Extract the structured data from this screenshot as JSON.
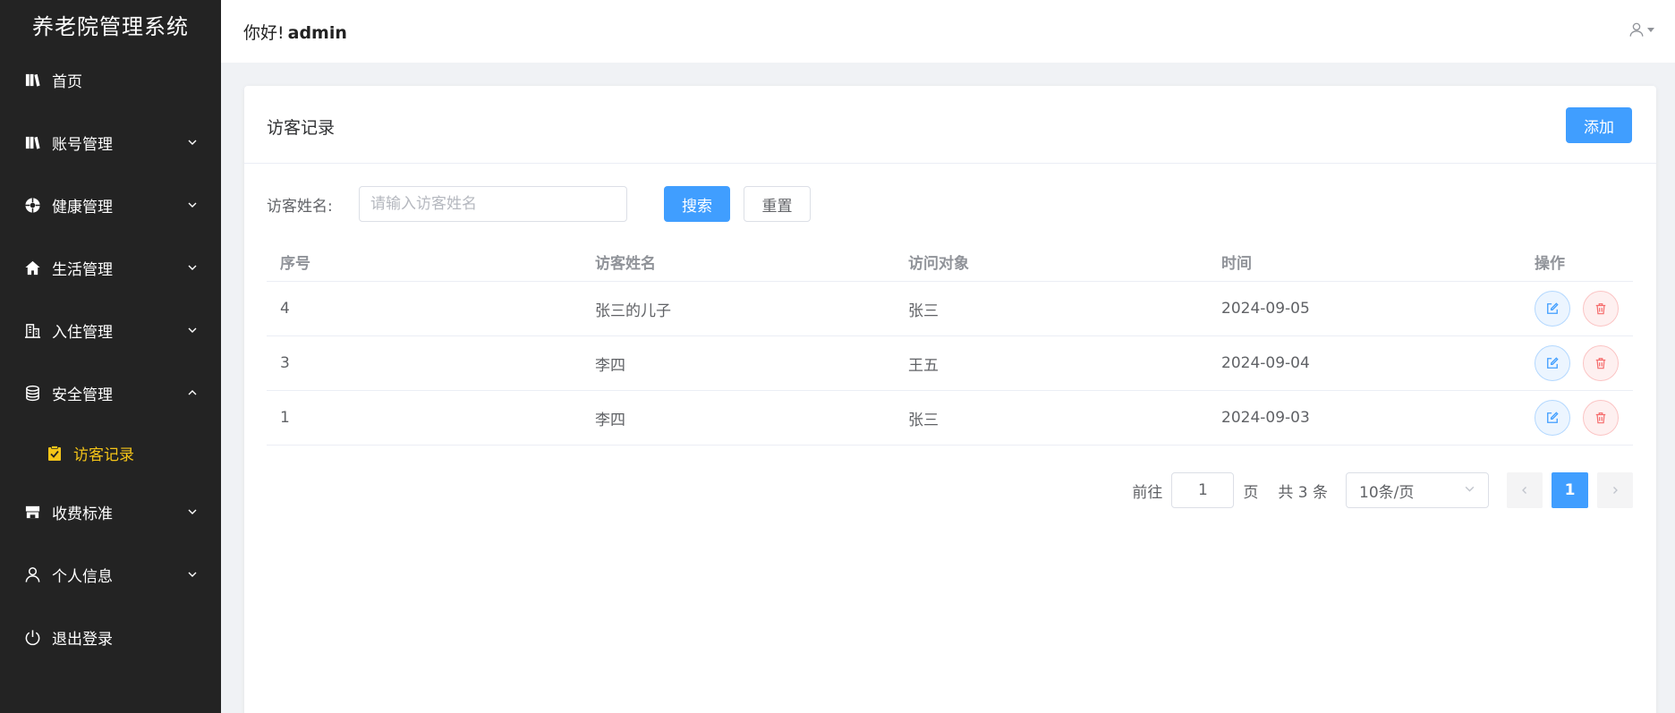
{
  "app": {
    "title": "养老院管理系统"
  },
  "sidebar": {
    "items": [
      {
        "label": "首页",
        "icon": "book-icon",
        "expandable": false
      },
      {
        "label": "账号管理",
        "icon": "book-icon",
        "expandable": true,
        "expanded": false
      },
      {
        "label": "健康管理",
        "icon": "aperture-icon",
        "expandable": true,
        "expanded": false
      },
      {
        "label": "生活管理",
        "icon": "home-icon",
        "expandable": true,
        "expanded": false
      },
      {
        "label": "入住管理",
        "icon": "building-icon",
        "expandable": true,
        "expanded": false
      },
      {
        "label": "安全管理",
        "icon": "database-icon",
        "expandable": true,
        "expanded": true
      },
      {
        "label": "访客记录",
        "icon": "clipboard-check-icon",
        "sub": true,
        "active": true
      },
      {
        "label": "收费标准",
        "icon": "shop-icon",
        "expandable": true,
        "expanded": false
      },
      {
        "label": "个人信息",
        "icon": "user-icon",
        "expandable": true,
        "expanded": false
      },
      {
        "label": "退出登录",
        "icon": "power-icon",
        "expandable": false
      }
    ],
    "active_color": "#f5c518",
    "background": "#232323"
  },
  "header": {
    "greeting": "你好!",
    "username": "admin",
    "user_icon": "user-icon"
  },
  "card": {
    "title": "访客记录",
    "add_label": "添加"
  },
  "search": {
    "label": "访客姓名:",
    "placeholder": "请输入访客姓名",
    "value": "",
    "search_label": "搜索",
    "reset_label": "重置"
  },
  "table": {
    "columns": [
      "序号",
      "访客姓名",
      "访问对象",
      "时间",
      "操作"
    ],
    "rows": [
      {
        "id": "4",
        "visitor": "张三的儿子",
        "target": "张三",
        "time": "2024-09-05"
      },
      {
        "id": "3",
        "visitor": "李四",
        "target": "王五",
        "time": "2024-09-04"
      },
      {
        "id": "1",
        "visitor": "李四",
        "target": "张三",
        "time": "2024-09-03"
      }
    ],
    "actions": [
      "edit-icon",
      "delete-icon"
    ]
  },
  "pagination": {
    "goto_prefix": "前往",
    "goto_value": "1",
    "goto_suffix": "页",
    "total_text": "共 3 条",
    "page_size": "10条/页",
    "current_page": "1"
  },
  "colors": {
    "primary": "#409eff",
    "danger": "#f56c6c"
  }
}
